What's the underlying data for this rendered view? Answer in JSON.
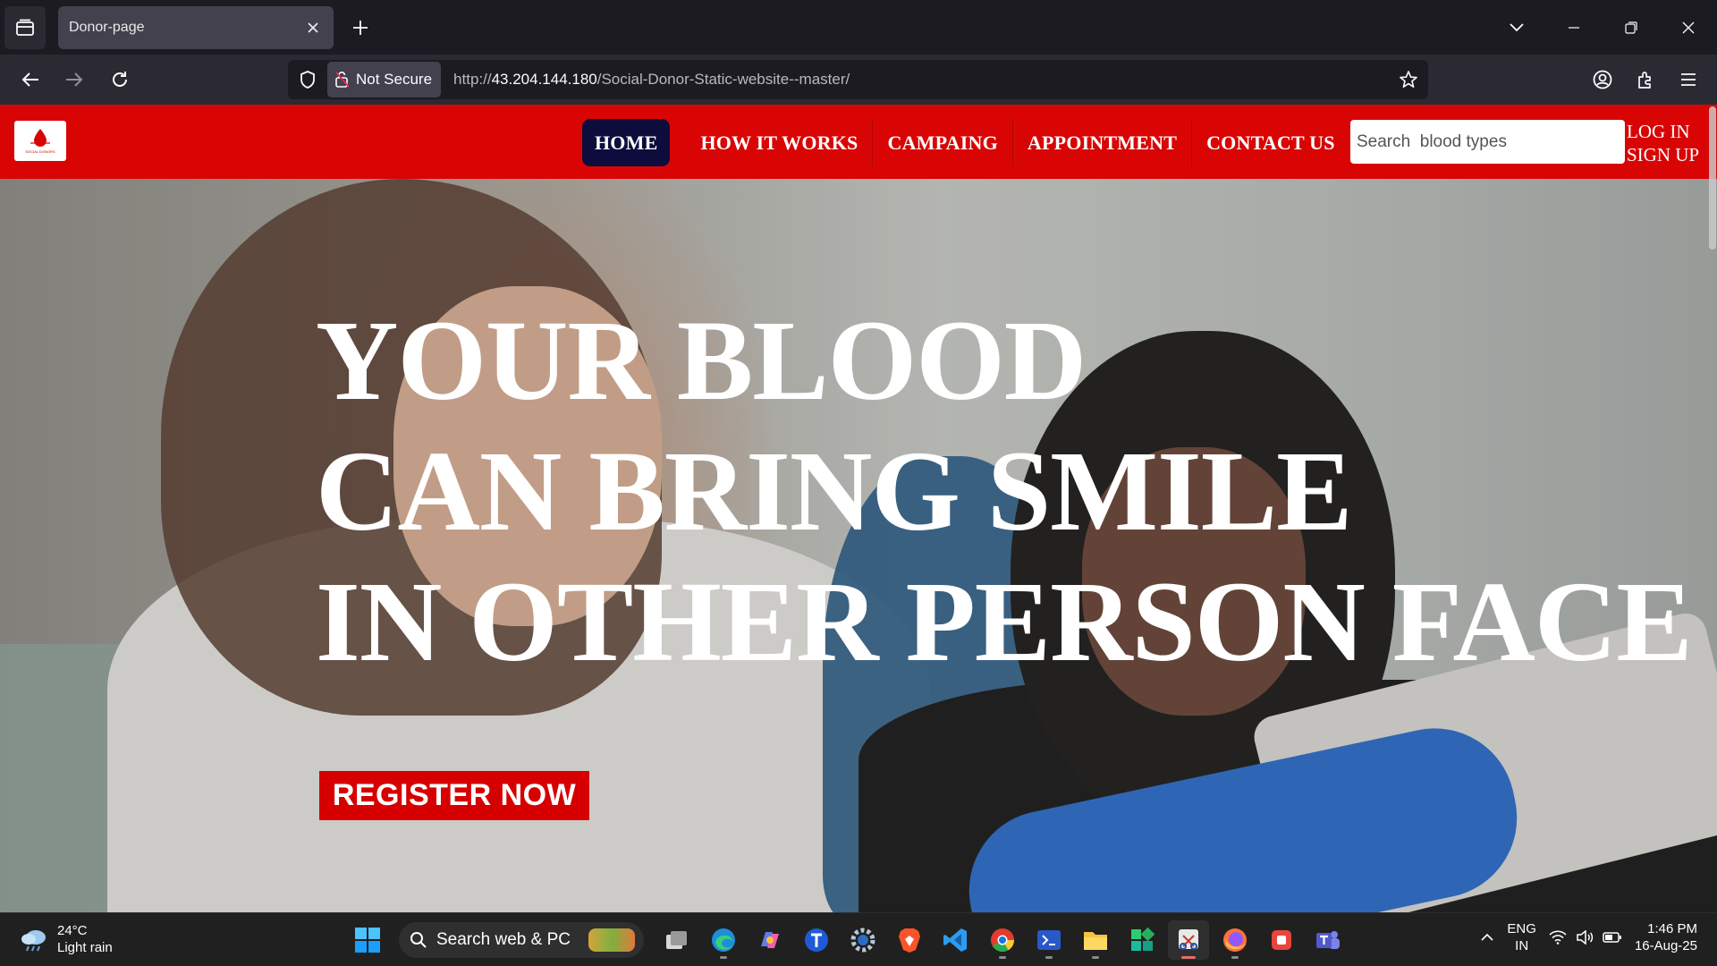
{
  "browser": {
    "tab_title": "Donor-page",
    "security_label": "Not Secure",
    "url_prefix": "http://",
    "url_host": "43.204.144.180",
    "url_path": "/Social-Donor-Static-website--master/"
  },
  "site": {
    "brand_colors": {
      "primary": "#d90505",
      "active_nav": "#0d0c3c"
    },
    "logo_text": "SOCIAL DONORS",
    "nav": [
      {
        "label": "HOME",
        "active": true
      },
      {
        "label": "HOW IT WORKS"
      },
      {
        "label": "CAMPAING"
      },
      {
        "label": "APPOINTMENT"
      },
      {
        "label": "CONTACT US"
      }
    ],
    "search_placeholder": "Search  blood types",
    "login_label": "LOG IN",
    "signup_label": "SIGN UP"
  },
  "hero": {
    "lines": [
      "YOUR BLOOD",
      "CAN BRING SMILE",
      "IN OTHER PERSON FACE"
    ],
    "cta_label": "REGISTER NOW"
  },
  "taskbar": {
    "weather_temp": "24°C",
    "weather_desc": "Light rain",
    "search_label": "Search web & PC",
    "lang_top": "ENG",
    "lang_bottom": "IN",
    "time": "1:46 PM",
    "date": "16-Aug-25",
    "apps": [
      "task-view-icon",
      "edge-icon",
      "copilot-icon",
      "t-app-icon",
      "settings-icon",
      "brave-icon",
      "vscode-icon",
      "chrome-icon",
      "terminal-icon",
      "file-explorer-icon",
      "grid-app-icon",
      "snipping-tool-icon",
      "firefox-icon",
      "red-app-icon",
      "teams-icon"
    ]
  }
}
